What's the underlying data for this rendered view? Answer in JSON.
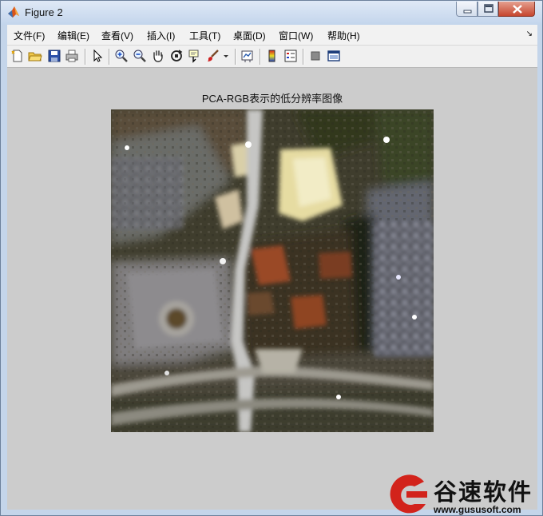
{
  "window": {
    "title": "Figure 2"
  },
  "menu": [
    "文件(F)",
    "编辑(E)",
    "查看(V)",
    "插入(I)",
    "工具(T)",
    "桌面(D)",
    "窗口(W)",
    "帮助(H)"
  ],
  "toolbar": {
    "icons": [
      "new-figure-icon",
      "open-file-icon",
      "save-icon",
      "print-icon",
      "select-arrow-icon",
      "zoom-in-icon",
      "zoom-out-icon",
      "pan-hand-icon",
      "rotate-3d-icon",
      "data-cursor-icon",
      "brush-icon",
      "brush-dropdown-icon",
      "link-plot-icon",
      "colorbar-icon",
      "legend-icon",
      "hide-plot-tools-icon",
      "show-plot-tools-icon"
    ]
  },
  "figure": {
    "title": "PCA-RGB表示的低分辨率图像"
  },
  "watermark": {
    "brand": "谷速软件",
    "url": "www.gususoft.com"
  },
  "colors": {
    "canvas": "#cccccc",
    "titlebar": "#c4d5ea",
    "close": "#c6462e",
    "watermark_red": "#d2231b"
  }
}
